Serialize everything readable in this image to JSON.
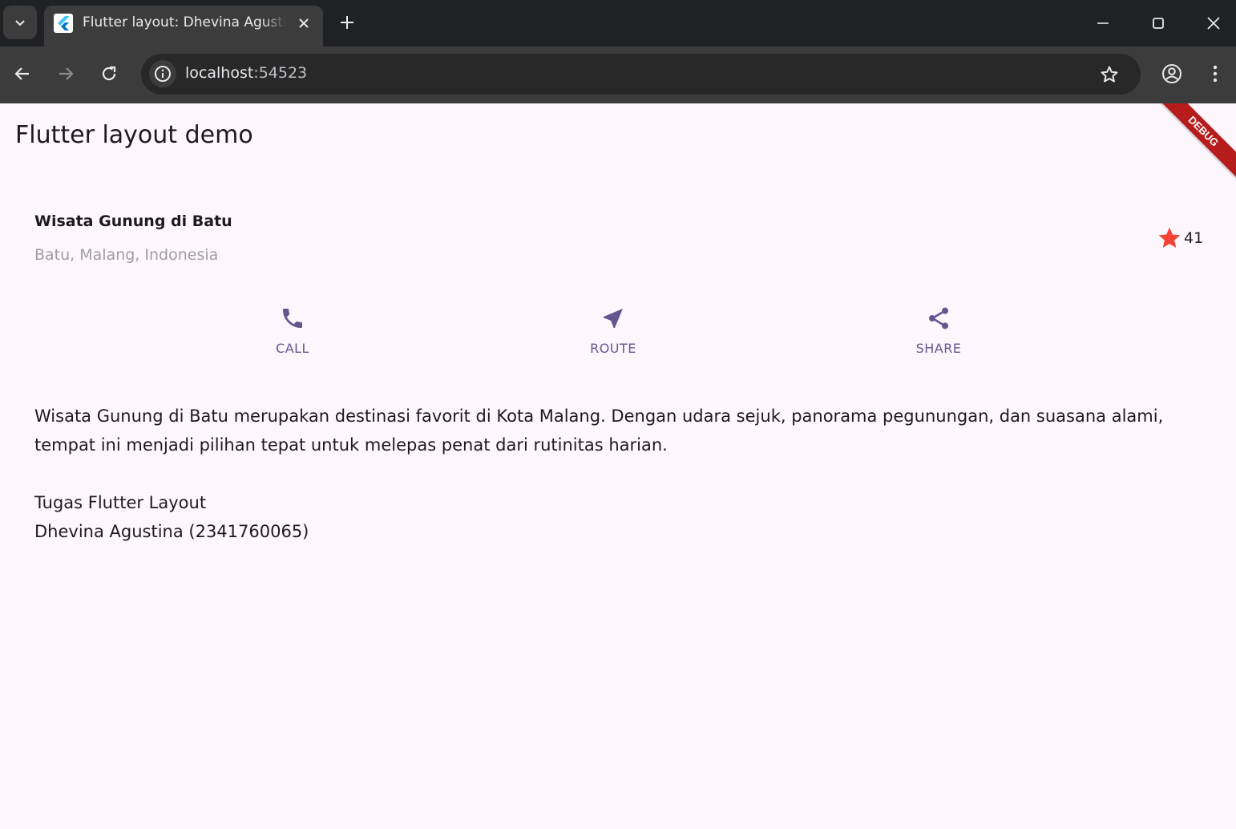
{
  "browser": {
    "tab_title": "Flutter layout: Dhevina Agustina",
    "url_host": "localhost",
    "url_port": ":54523"
  },
  "app": {
    "appbar_title": "Flutter layout demo",
    "debug_banner": "DEBUG",
    "place_title": "Wisata Gunung di Batu",
    "place_location": "Batu, Malang, Indonesia",
    "rating_count": "41",
    "star_color": "#f44336",
    "accent_color": "#65558f",
    "actions": [
      {
        "icon": "call-icon",
        "label": "CALL"
      },
      {
        "icon": "route-icon",
        "label": "ROUTE"
      },
      {
        "icon": "share-icon",
        "label": "SHARE"
      }
    ],
    "description": "Wisata Gunung di Batu merupakan destinasi favorit di Kota Malang. Dengan udara sejuk, panorama pegunungan, dan suasana alami, tempat ini menjadi pilihan tepat untuk melepas penat dari rutinitas harian.\n\nTugas Flutter Layout\nDhevina Agustina (2341760065)"
  }
}
